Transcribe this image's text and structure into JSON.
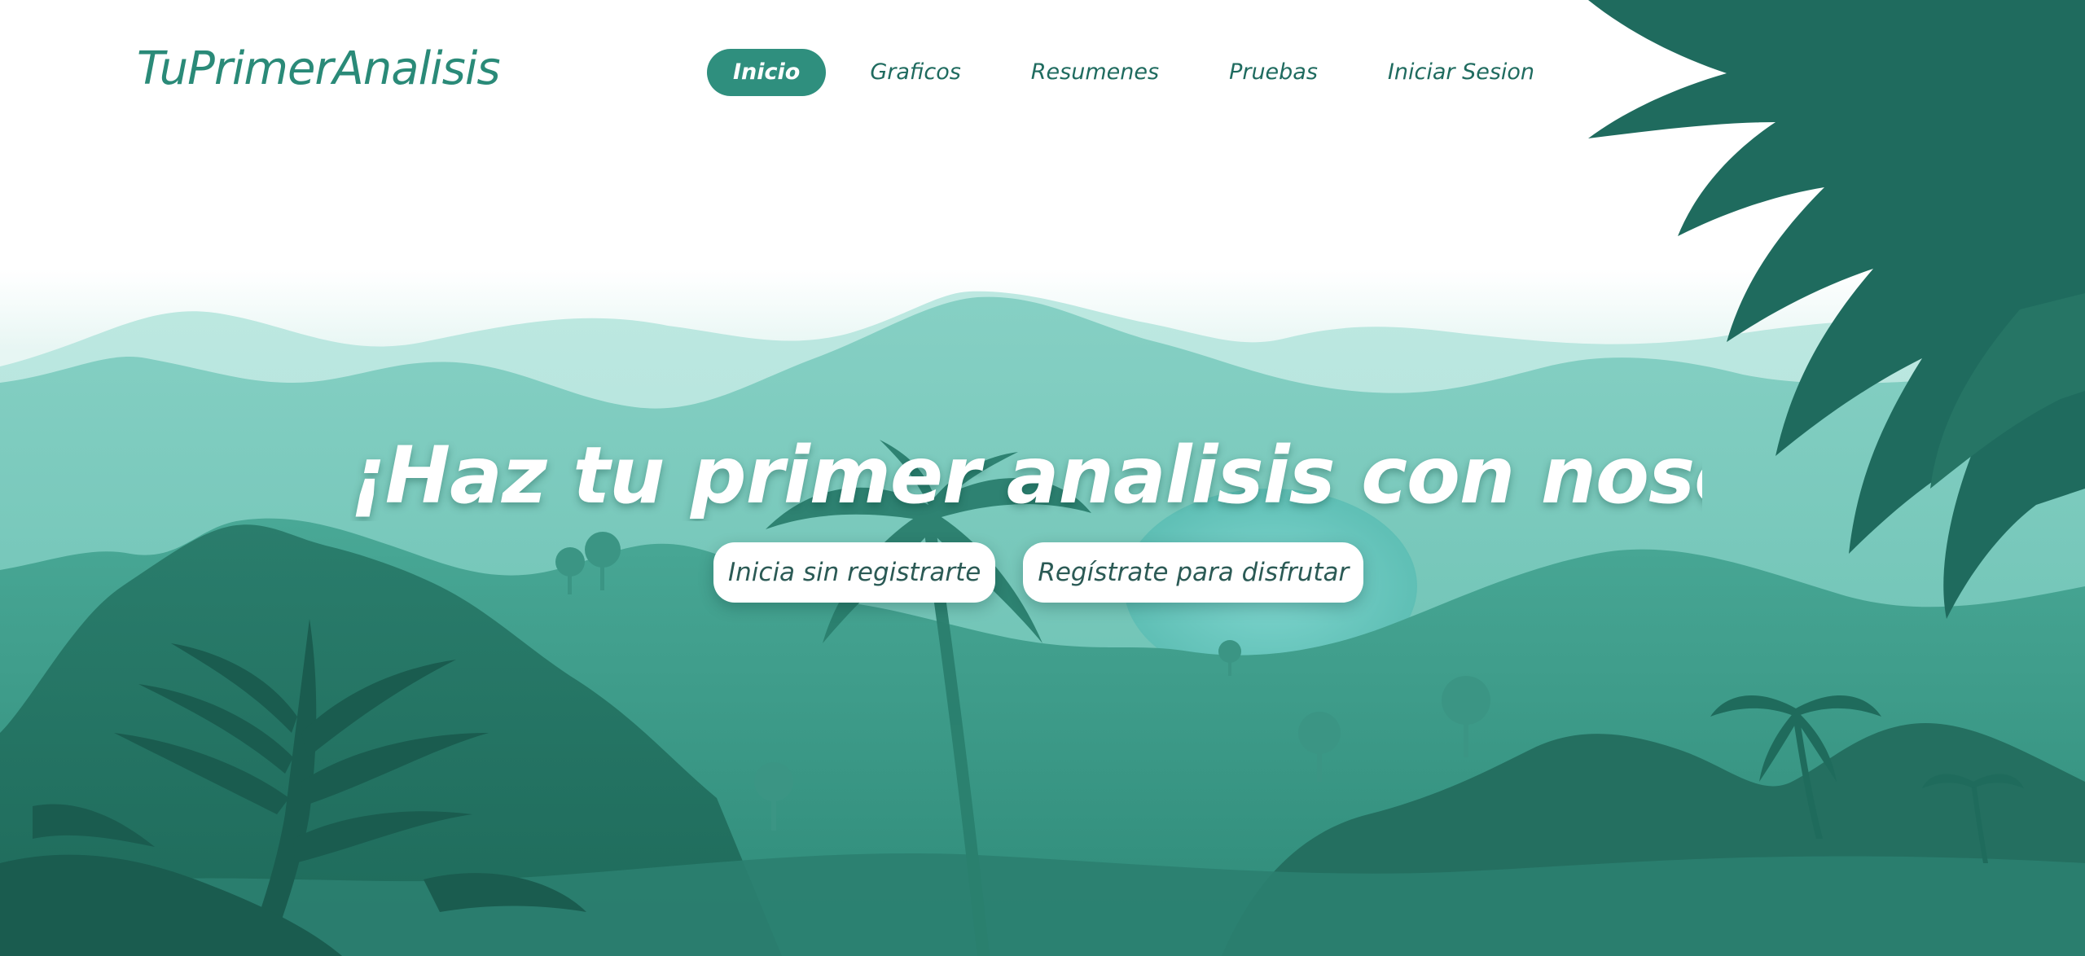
{
  "header": {
    "logo_text": "TuPrimerAnalisis",
    "nav": [
      {
        "label": "Inicio",
        "active": true
      },
      {
        "label": "Graficos",
        "active": false
      },
      {
        "label": "Resumenes",
        "active": false
      },
      {
        "label": "Pruebas",
        "active": false
      },
      {
        "label": "Iniciar Sesion",
        "active": false
      }
    ]
  },
  "hero": {
    "title": "¡Haz tu primer analisis con nosotros!",
    "buttons": [
      {
        "label": "Inicia sin registrarte"
      },
      {
        "label": "Regístrate para disfrutar"
      }
    ]
  },
  "colors": {
    "accent": "#2f8f7e",
    "logo": "#2a8a78",
    "nav_text": "#1f6b5f"
  },
  "background": {
    "illustration": "tropical-jungle-landscape",
    "icons": [
      "palm-tree-icon",
      "fern-leaf-icon",
      "mountain-icon"
    ]
  }
}
